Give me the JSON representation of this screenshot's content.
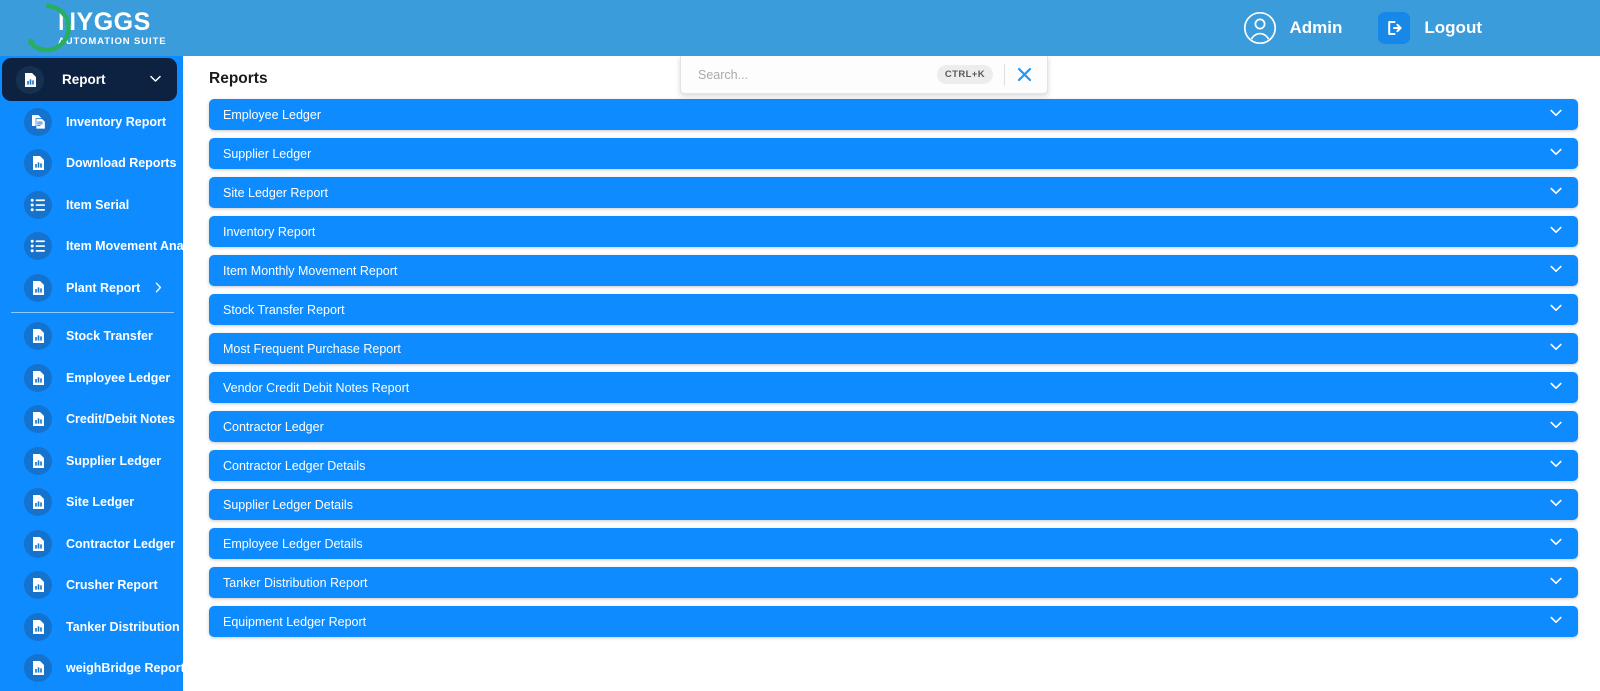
{
  "header": {
    "logo_main": "NYGGS",
    "logo_sub": "AUTOMATION SUITE",
    "user_label": "Admin",
    "logout_label": "Logout",
    "bg_color": "#3b9cdb"
  },
  "sidebar": {
    "bg_color": "#0d8bff",
    "head": {
      "label": "Report",
      "icon": "report-chart-doc-icon",
      "chevron": "chevron-down-icon"
    },
    "items": [
      {
        "label": "Inventory Report",
        "icon": "document-list-icon",
        "submenu": false
      },
      {
        "label": "Download Reports",
        "icon": "report-chart-doc-icon",
        "submenu": false
      },
      {
        "label": "Item Serial",
        "icon": "list-lines-icon",
        "submenu": false
      },
      {
        "label": "Item Movement Analy",
        "icon": "list-lines-icon",
        "submenu": false
      },
      {
        "label": "Plant Report",
        "icon": "report-chart-doc-icon",
        "submenu": true,
        "submenu_icon": "chevron-right-icon",
        "divider_after": true
      },
      {
        "label": "Stock Transfer",
        "icon": "report-chart-doc-icon",
        "submenu": false
      },
      {
        "label": "Employee Ledger",
        "icon": "report-chart-doc-icon",
        "submenu": false
      },
      {
        "label": "Credit/Debit Notes",
        "icon": "report-chart-doc-icon",
        "submenu": false
      },
      {
        "label": "Supplier Ledger",
        "icon": "report-chart-doc-icon",
        "submenu": false
      },
      {
        "label": "Site Ledger",
        "icon": "report-chart-doc-icon",
        "submenu": false
      },
      {
        "label": "Contractor Ledger",
        "icon": "report-chart-doc-icon",
        "submenu": false
      },
      {
        "label": "Crusher Report",
        "icon": "report-chart-doc-icon",
        "submenu": false
      },
      {
        "label": "Tanker Distribution",
        "icon": "report-chart-doc-icon",
        "submenu": false
      },
      {
        "label": "weighBridge Report",
        "icon": "report-chart-doc-icon",
        "submenu": false
      }
    ]
  },
  "main": {
    "page_title": "Reports",
    "accent_color": "#0d8bff"
  },
  "search": {
    "placeholder": "Search...",
    "value": "",
    "shortcut": "CTRL+K",
    "close_icon": "close-icon"
  },
  "reports": [
    {
      "label": "Employee Ledger",
      "chevron": "chevron-down-icon"
    },
    {
      "label": "Supplier Ledger",
      "chevron": "chevron-down-icon"
    },
    {
      "label": "Site Ledger Report",
      "chevron": "chevron-down-icon"
    },
    {
      "label": "Inventory Report",
      "chevron": "chevron-down-icon"
    },
    {
      "label": "Item Monthly Movement Report",
      "chevron": "chevron-down-icon"
    },
    {
      "label": "Stock Transfer Report",
      "chevron": "chevron-down-icon"
    },
    {
      "label": "Most Frequent Purchase Report",
      "chevron": "chevron-down-icon"
    },
    {
      "label": "Vendor Credit Debit Notes Report",
      "chevron": "chevron-down-icon"
    },
    {
      "label": "Contractor Ledger",
      "chevron": "chevron-down-icon"
    },
    {
      "label": "Contractor Ledger Details",
      "chevron": "chevron-down-icon"
    },
    {
      "label": "Supplier Ledger Details",
      "chevron": "chevron-down-icon"
    },
    {
      "label": "Employee Ledger Details",
      "chevron": "chevron-down-icon"
    },
    {
      "label": "Tanker Distribution Report",
      "chevron": "chevron-down-icon"
    },
    {
      "label": "Equipment Ledger Report",
      "chevron": "chevron-down-icon"
    }
  ]
}
